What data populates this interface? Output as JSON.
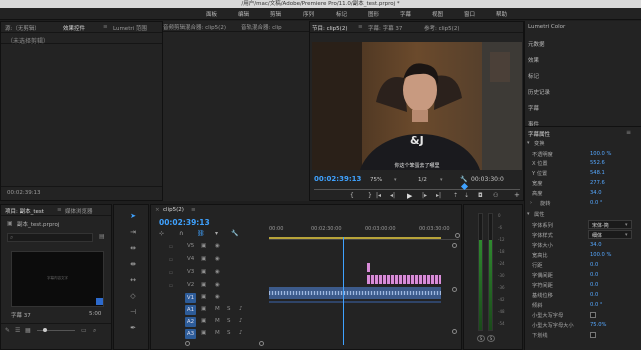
{
  "window_title": "/用户/mac/文稿/Adobe/Premiere Pro/11.0/副本_test.prproj *",
  "menu": [
    "面板",
    "编辑",
    "剪辑",
    "序列",
    "标记",
    "图形",
    "字幕",
    "视图",
    "窗口",
    "帮助"
  ],
  "source_panel": {
    "tabs": [
      "源:（无剪辑）",
      "效果控件",
      "Lumetri 范围",
      "音频剪辑混合器: clip5(2)",
      "音轨混合器: clip"
    ],
    "active_tab": "效果控件",
    "empty_label": "（未选择剪辑）",
    "timecode": "00:02:39:13"
  },
  "program_panel": {
    "tabs": [
      "节目: clip5(2)",
      "字幕: 字幕 37",
      "参考: clip5(2)"
    ],
    "timecode_current": "00:02:39:13",
    "zoom": "75%",
    "quality": "1/2",
    "timecode_duration": "00:03:30:0",
    "video_caption": "你这个笨蛋去了哪里"
  },
  "project_panel": {
    "tabs": [
      "项目: 副本_test",
      "媒体浏览器"
    ],
    "file_name": "副本_test.prproj",
    "thumb_name": "字幕 37",
    "thumb_duration": "5:00",
    "thumb_text": "字幕内容文字"
  },
  "timeline": {
    "tab": "clip5(2)",
    "timecode": "00:02:39:13",
    "ruler": [
      "00:00",
      "00:02:30:00",
      "00:03:00:00",
      "00:03:30:00"
    ],
    "video_tracks": [
      "V5",
      "V4",
      "V3",
      "V2",
      "V1"
    ],
    "audio_tracks": [
      "A1",
      "A2",
      "A3"
    ],
    "mute_label": "M",
    "solo_label": "S"
  },
  "right_panel": {
    "items": [
      "Lumetri Color",
      "元数据",
      "效果",
      "标记",
      "历史记录",
      "字幕",
      "事件"
    ],
    "title_props_header": "字幕属性",
    "section_transform": "变换",
    "transform": [
      {
        "label": "不透明度",
        "value": "100.0 %"
      },
      {
        "label": "X 位置",
        "value": "552.6"
      },
      {
        "label": "Y 位置",
        "value": "548.1"
      },
      {
        "label": "宽度",
        "value": "277.6"
      },
      {
        "label": "高度",
        "value": "34.0"
      },
      {
        "label": "旋转",
        "value": "0.0 °"
      }
    ],
    "section_attributes": "属性",
    "attributes": [
      {
        "label": "字体系列",
        "value": "宋体-简"
      },
      {
        "label": "字体样式",
        "value": "细体"
      },
      {
        "label": "字体大小",
        "value": "34.0"
      },
      {
        "label": "宽高比",
        "value": "100.0 %"
      },
      {
        "label": "行距",
        "value": "0.0"
      },
      {
        "label": "字偶间距",
        "value": "0.0"
      },
      {
        "label": "字符间距",
        "value": "0.0"
      },
      {
        "label": "基线位移",
        "value": "0.0"
      },
      {
        "label": "倾斜",
        "value": "0.0 °"
      },
      {
        "label": "小型大写字母",
        "value": ""
      },
      {
        "label": "小型大写字母大小",
        "value": "75.0%"
      },
      {
        "label": "下划线",
        "value": ""
      }
    ]
  },
  "audio_meter": {
    "scale": [
      "0",
      "-6",
      "-12",
      "-18",
      "-24",
      "-30",
      "-36",
      "-42",
      "-48",
      "-54"
    ],
    "solo_labels": [
      "S",
      "S"
    ]
  }
}
